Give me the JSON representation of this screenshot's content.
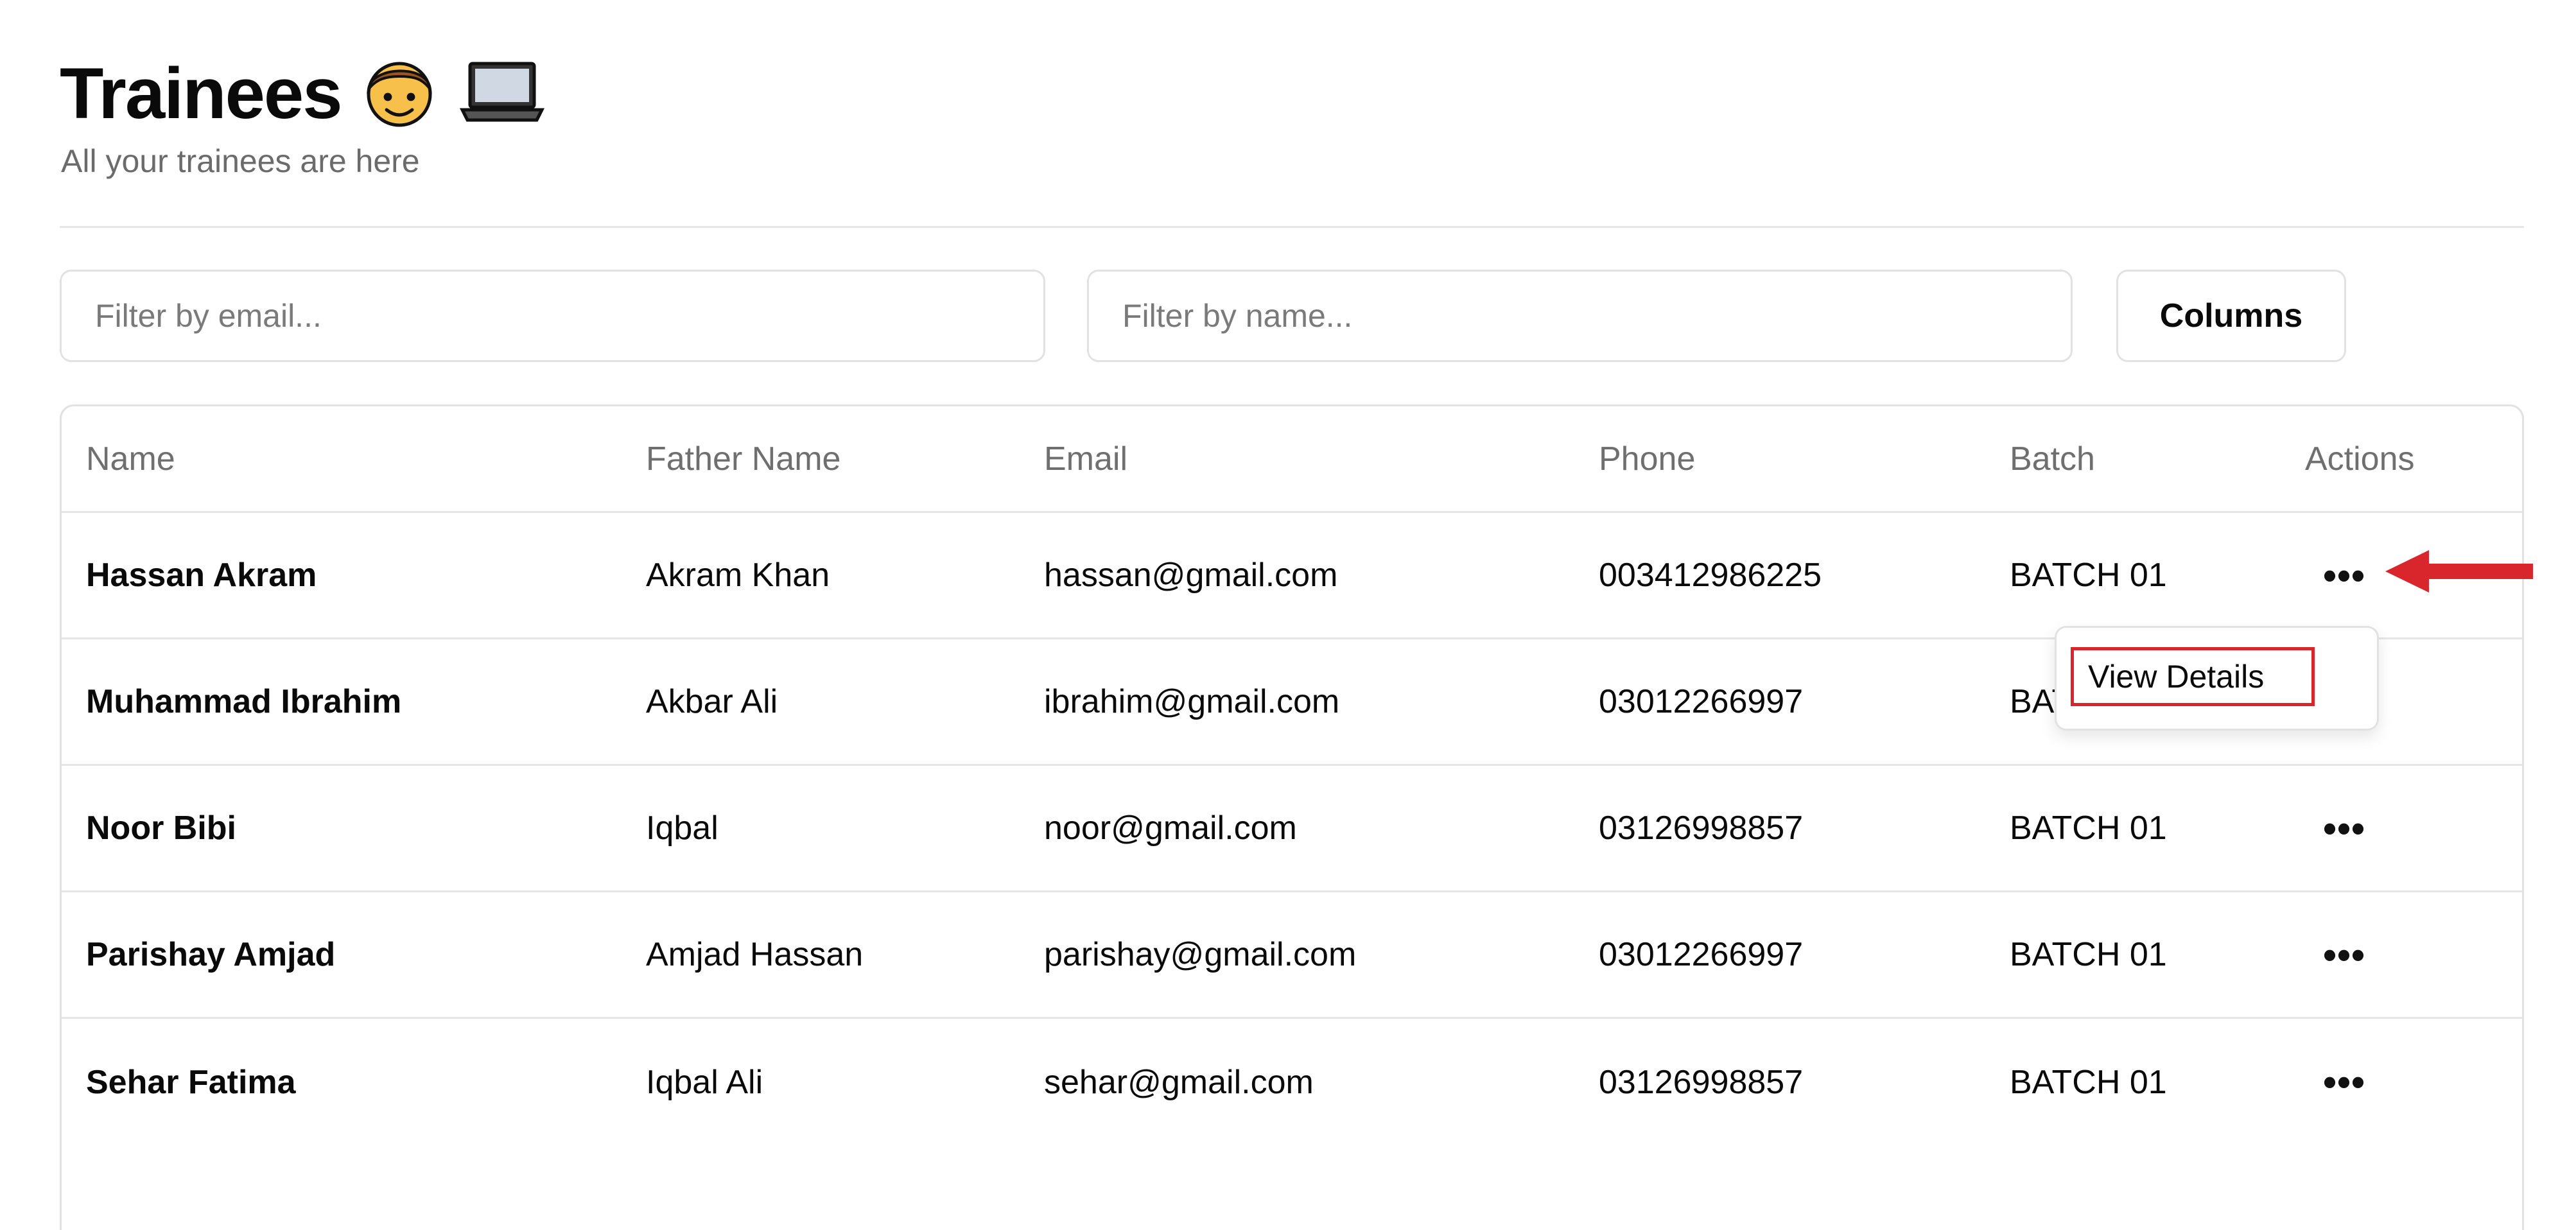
{
  "header": {
    "title": "Trainees",
    "emojis": [
      "boy-face-icon",
      "laptop-icon"
    ],
    "subtitle": "All your trainees are here"
  },
  "filters": {
    "email_placeholder": "Filter by email...",
    "name_placeholder": "Filter by name...",
    "columns_label": "Columns"
  },
  "table": {
    "columns": [
      "Name",
      "Father Name",
      "Email",
      "Phone",
      "Batch",
      "Actions"
    ],
    "rows": [
      {
        "name": "Hassan Akram",
        "father": "Akram Khan",
        "email": "hassan@gmail.com",
        "phone": "003412986225",
        "batch": "BATCH 01",
        "actions": "•••"
      },
      {
        "name": "Muhammad Ibrahim",
        "father": "Akbar Ali",
        "email": "ibrahim@gmail.com",
        "phone": "03012266997",
        "batch": "BATCH 01",
        "actions": "•••"
      },
      {
        "name": "Noor Bibi",
        "father": "Iqbal",
        "email": "noor@gmail.com",
        "phone": "03126998857",
        "batch": "BATCH 01",
        "actions": "•••"
      },
      {
        "name": "Parishay Amjad",
        "father": "Amjad Hassan",
        "email": "parishay@gmail.com",
        "phone": "03012266997",
        "batch": "BATCH 01",
        "actions": "•••"
      },
      {
        "name": "Sehar Fatima",
        "father": "Iqbal Ali",
        "email": "sehar@gmail.com",
        "phone": "03126998857",
        "batch": "BATCH 01",
        "actions": "•••"
      }
    ]
  },
  "dropdown": {
    "item_label": "View Details"
  },
  "annotation": {
    "arrow_color": "#d9262c",
    "highlight_color": "#d9262c"
  }
}
